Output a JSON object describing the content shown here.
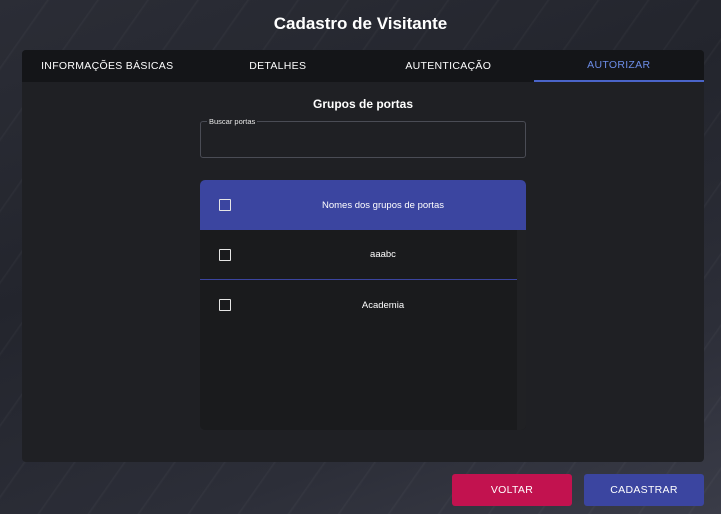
{
  "page": {
    "title": "Cadastro de Visitante"
  },
  "tabs": [
    {
      "label": "INFORMAÇÕES BÁSICAS",
      "active": false
    },
    {
      "label": "DETALHES",
      "active": false
    },
    {
      "label": "AUTENTICAÇÃO",
      "active": false
    },
    {
      "label": "AUTORIZAR",
      "active": true
    }
  ],
  "section": {
    "title": "Grupos de portas"
  },
  "search": {
    "label": "Buscar portas",
    "value": "",
    "placeholder": ""
  },
  "table": {
    "header": "Nomes dos grupos de portas",
    "rows": [
      {
        "name": "aaabc",
        "checked": false
      },
      {
        "name": "Academia",
        "checked": false
      }
    ]
  },
  "buttons": {
    "back": "VOLTAR",
    "submit": "CADASTRAR"
  },
  "colors": {
    "accent": "#3b45a0",
    "danger": "#c2124f",
    "active_tab": "#6c8ce6"
  }
}
